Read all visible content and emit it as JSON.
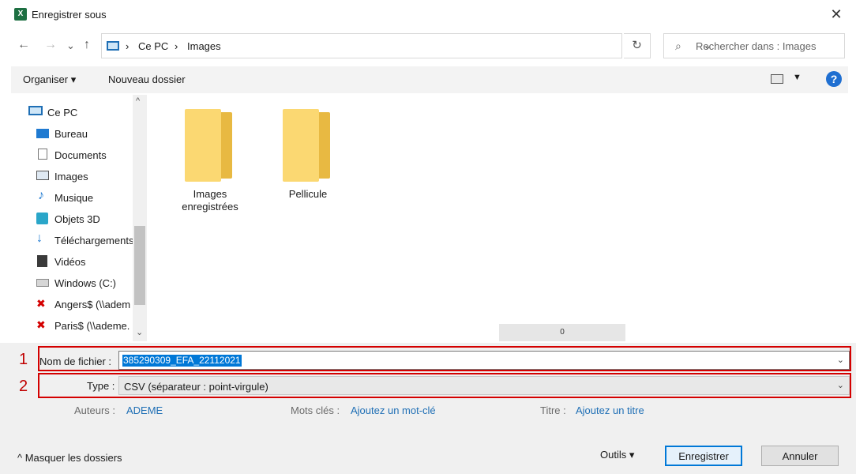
{
  "window": {
    "title": "Enregistrer sous",
    "app_icon_glyph": "X",
    "close_glyph": "✕"
  },
  "nav": {
    "back": "←",
    "forward": "→",
    "recent": "⌄",
    "up": "↑"
  },
  "address": {
    "crumbs": [
      "Ce PC",
      "Images"
    ],
    "separator": "›",
    "dropdown": "⌄",
    "refresh": "↻"
  },
  "search": {
    "placeholder": "Rechercher dans : Images",
    "icon": "⌕"
  },
  "toolbar": {
    "organiser": "Organiser ▾",
    "new_folder": "Nouveau dossier",
    "view_dropdown": "▼",
    "help": "?"
  },
  "sidebar": {
    "items": [
      {
        "label": "Ce PC",
        "icon": "pc-icon"
      },
      {
        "label": "Bureau",
        "icon": "desktop-icon"
      },
      {
        "label": "Documents",
        "icon": "documents-icon"
      },
      {
        "label": "Images",
        "icon": "images-icon"
      },
      {
        "label": "Musique",
        "icon": "music-icon"
      },
      {
        "label": "Objets 3D",
        "icon": "3d-objects-icon"
      },
      {
        "label": "Téléchargements",
        "icon": "downloads-icon"
      },
      {
        "label": "Vidéos",
        "icon": "videos-icon"
      },
      {
        "label": "Windows (C:)",
        "icon": "drive-icon"
      },
      {
        "label": "Angers$ (\\\\adem",
        "icon": "network-drive-disconnected-icon"
      },
      {
        "label": "Paris$ (\\\\ademe.",
        "icon": "network-drive-disconnected-icon"
      }
    ],
    "scroll_up": "^",
    "scroll_down": "⌄"
  },
  "content": {
    "folders": [
      {
        "label": "Images enregistrées"
      },
      {
        "label": "Pellicule"
      }
    ],
    "scroll_badge": "0"
  },
  "form": {
    "marker1": "1",
    "marker2": "2",
    "filename_label": "Nom de fichier :",
    "filename_value": "385290309_EFA_22112021",
    "type_label": "Type :",
    "type_value": "CSV (séparateur : point-virgule)",
    "chevron": "⌄"
  },
  "meta": {
    "authors_label": "Auteurs :",
    "authors_value": "ADEME",
    "keywords_label": "Mots clés :",
    "keywords_value": "Ajoutez un mot-clé",
    "title_label": "Titre :",
    "title_value": "Ajoutez un titre"
  },
  "footer": {
    "hide_folders": "^ Masquer les dossiers",
    "tools": "Outils ▾",
    "save": "Enregistrer",
    "cancel": "Annuler"
  },
  "colors": {
    "accent": "#0078d7",
    "highlight_box": "#d40000",
    "folder": "#fbd872",
    "link": "#1f6fb5"
  }
}
